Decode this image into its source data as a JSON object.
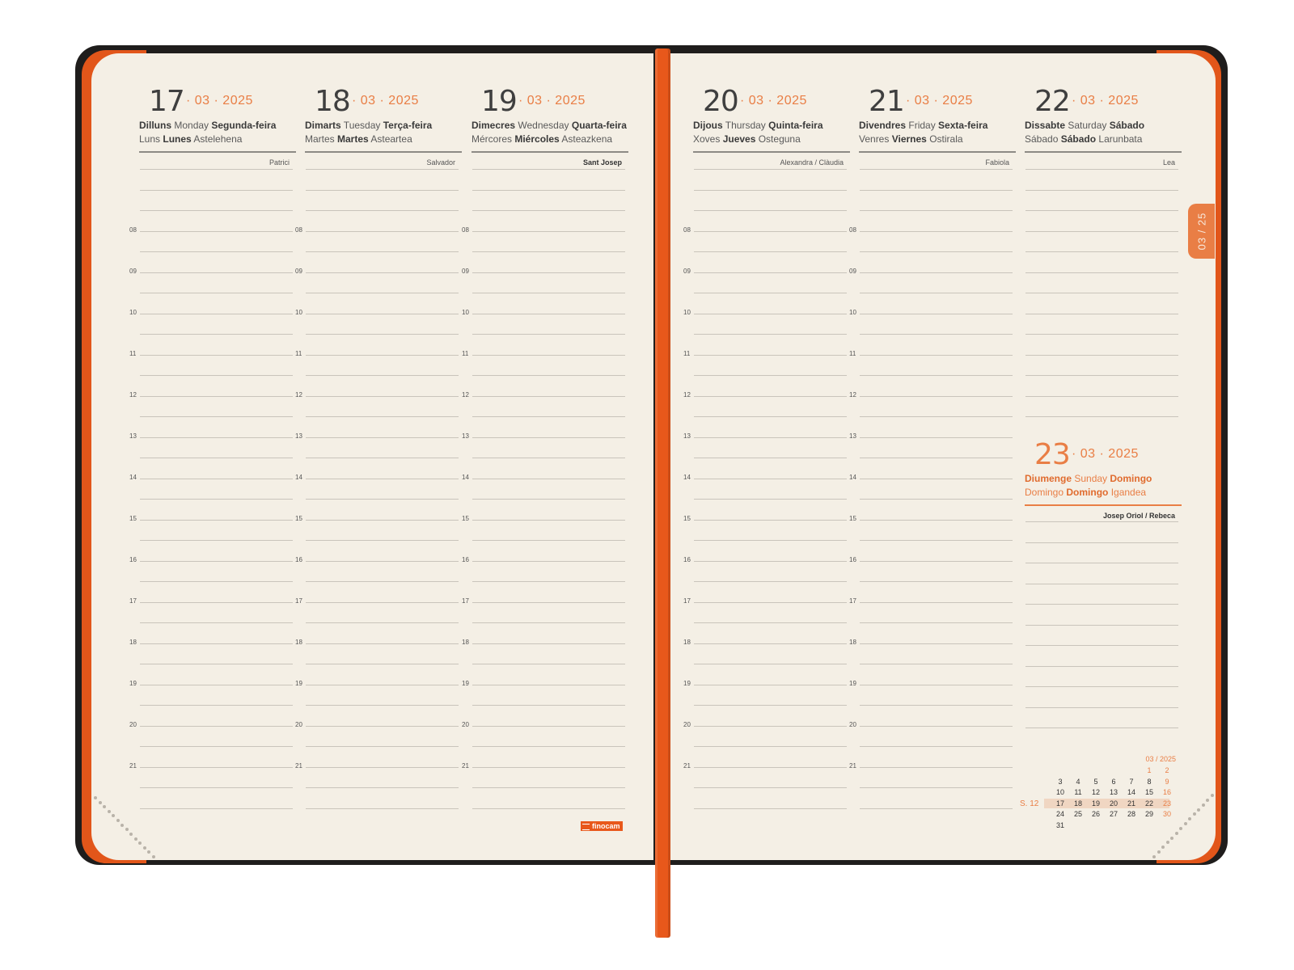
{
  "left_page": {
    "days": [
      {
        "day": "17",
        "month_year": "· 03 · 2025",
        "line1": [
          [
            "b",
            "Dilluns"
          ],
          [
            "n",
            " Monday "
          ],
          [
            "b",
            "Segunda-feira"
          ]
        ],
        "line2": [
          [
            "n",
            "Luns "
          ],
          [
            "b",
            "Lunes"
          ],
          [
            "n",
            " Astelehena"
          ]
        ],
        "saint": "Patrici",
        "saint_bold": false
      },
      {
        "day": "18",
        "month_year": "· 03 · 2025",
        "line1": [
          [
            "b",
            "Dimarts"
          ],
          [
            "n",
            " Tuesday "
          ],
          [
            "b",
            "Terça-feira"
          ]
        ],
        "line2": [
          [
            "n",
            "Martes "
          ],
          [
            "b",
            "Martes"
          ],
          [
            "n",
            " Asteartea"
          ]
        ],
        "saint": "Salvador",
        "saint_bold": false
      },
      {
        "day": "19",
        "month_year": "· 03 · 2025",
        "line1": [
          [
            "b",
            "Dimecres"
          ],
          [
            "n",
            " Wednesday "
          ],
          [
            "b",
            "Quarta-feira"
          ]
        ],
        "line2": [
          [
            "n",
            "Mércores "
          ],
          [
            "b",
            "Miércoles"
          ],
          [
            "n",
            " Asteazkena"
          ]
        ],
        "saint": "Sant Josep",
        "saint_bold": true
      }
    ],
    "logo": "finocam"
  },
  "right_page": {
    "days": [
      {
        "day": "20",
        "month_year": "· 03 · 2025",
        "line1": [
          [
            "b",
            "Dijous"
          ],
          [
            "n",
            " Thursday "
          ],
          [
            "b",
            "Quinta-feira"
          ]
        ],
        "line2": [
          [
            "n",
            "Xoves "
          ],
          [
            "b",
            "Jueves"
          ],
          [
            "n",
            " Osteguna"
          ]
        ],
        "saint": "Alexandra / Clàudia",
        "saint_bold": false
      },
      {
        "day": "21",
        "month_year": "· 03 · 2025",
        "line1": [
          [
            "b",
            "Divendres"
          ],
          [
            "n",
            " Friday "
          ],
          [
            "b",
            "Sexta-feira"
          ]
        ],
        "line2": [
          [
            "n",
            "Venres "
          ],
          [
            "b",
            "Viernes"
          ],
          [
            "n",
            " Ostirala"
          ]
        ],
        "saint": "Fabiola",
        "saint_bold": false
      },
      {
        "day": "22",
        "month_year": "· 03 · 2025",
        "line1": [
          [
            "b",
            "Dissabte"
          ],
          [
            "n",
            " Saturday "
          ],
          [
            "b",
            "Sábado"
          ]
        ],
        "line2": [
          [
            "n",
            "Sábado "
          ],
          [
            "b",
            "Sábado"
          ],
          [
            "n",
            " Larunbata"
          ]
        ],
        "saint": "Lea",
        "saint_bold": false
      }
    ],
    "sunday": {
      "day": "23",
      "month_year": "· 03 · 2025",
      "line1": [
        [
          "b",
          "Diumenge"
        ],
        [
          "n",
          " Sunday "
        ],
        [
          "b",
          "Domingo"
        ]
      ],
      "line2": [
        [
          "n",
          "Domingo "
        ],
        [
          "b",
          "Domingo"
        ],
        [
          "n",
          " Igandea"
        ]
      ],
      "saint": "Josep Oriol / Rebeca",
      "saint_bold": true
    },
    "tab_label": "03 / 25",
    "mini_calendar": {
      "title": "03 / 2025",
      "week_label": "S. 12",
      "rows": [
        [
          "",
          "",
          "",
          "",
          "",
          "1",
          "2"
        ],
        [
          "3",
          "4",
          "5",
          "6",
          "7",
          "8",
          "9"
        ],
        [
          "10",
          "11",
          "12",
          "13",
          "14",
          "15",
          "16"
        ],
        [
          "17",
          "18",
          "19",
          "20",
          "21",
          "22",
          "23"
        ],
        [
          "24",
          "25",
          "26",
          "27",
          "28",
          "29",
          "30"
        ],
        [
          "31",
          "",
          "",
          "",
          "",
          "",
          ""
        ]
      ],
      "highlight_row": 3
    }
  },
  "hours": [
    "08",
    "09",
    "10",
    "11",
    "12",
    "13",
    "14",
    "15",
    "16",
    "17",
    "18",
    "19",
    "20",
    "21"
  ],
  "colors": {
    "cover": "#1f1d1c",
    "accent": "#e97e45",
    "ribbon": "#e8581b",
    "paper": "#f4efe5"
  }
}
